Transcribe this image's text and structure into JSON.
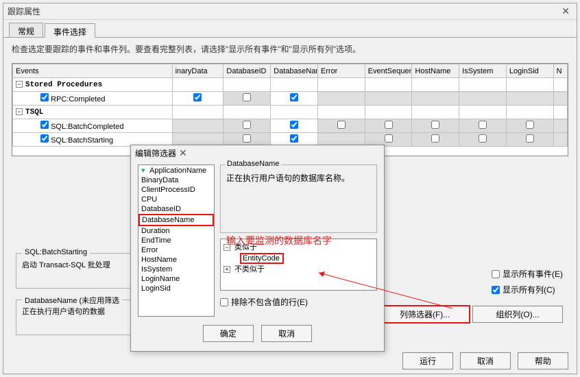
{
  "window": {
    "title": "跟踪属性"
  },
  "tabs": {
    "general": "常规",
    "events": "事件选择"
  },
  "instruction": "检查选定要跟踪的事件和事件列。要查看完整列表，请选择\"显示所有事件\"和\"显示所有列\"选项。",
  "columns": [
    "Events",
    "inaryData",
    "DatabaseID",
    "DatabaseName",
    "Error",
    "EventSequence",
    "HostName",
    "IsSystem",
    "LoginSid",
    "N"
  ],
  "rows": {
    "sp_group": "Stored Procedures",
    "rpc": "RPC:Completed",
    "tsql_group": "TSQL",
    "batch_comp": "SQL:BatchCompleted",
    "batch_start": "SQL:BatchStarting"
  },
  "desc1_title": "SQL:BatchStarting",
  "desc1_body": "启动 Transact-SQL 批处理",
  "desc2_title": "DatabaseName (未应用筛选",
  "desc2_body": "正在执行用户语句的数据",
  "opts": {
    "show_all_events": "显示所有事件(E)",
    "show_all_cols": "显示所有列(C)",
    "col_filter": "列筛选器(F)...",
    "organize": "组织列(O)..."
  },
  "buttons": {
    "run": "运行",
    "cancel": "取消",
    "help": "帮助"
  },
  "filter": {
    "title": "编辑筛选器",
    "items": [
      "ApplicationName",
      "BinaryData",
      "ClientProcessID",
      "CPU",
      "DatabaseID",
      "DatabaseName",
      "Duration",
      "EndTime",
      "Error",
      "HostName",
      "IsSystem",
      "LoginName",
      "LoginSid"
    ],
    "field_label": "DatabaseName",
    "field_desc": "正在执行用户语句的数据库名称。",
    "tree_like": "类似于",
    "tree_notlike": "不类似于",
    "value": "EntityCode",
    "exclude": "排除不包含值的行(E)",
    "ok": "确定",
    "cancel": "取消"
  },
  "annot": {
    "main": "输入要监测的数据库名字"
  }
}
